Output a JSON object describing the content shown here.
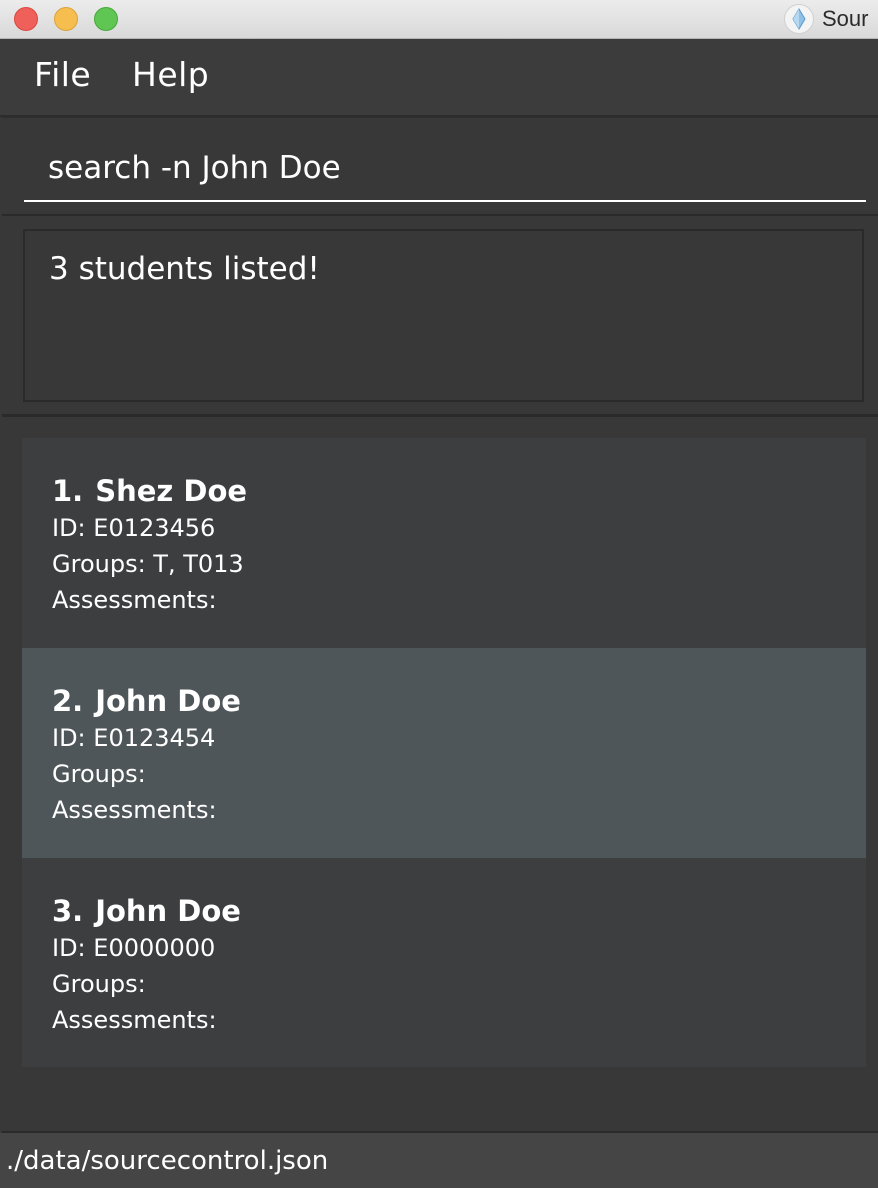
{
  "window": {
    "title": "Sour",
    "icon": "diamond-logo-icon"
  },
  "menu": {
    "file": "File",
    "help": "Help"
  },
  "command": {
    "value": "search -n John Doe"
  },
  "result": {
    "message": "3 students listed!"
  },
  "students": [
    {
      "index": "1.",
      "name": "Shez Doe",
      "id": "ID: E0123456",
      "groups": "Groups: T, T013",
      "assessments": "Assessments:"
    },
    {
      "index": "2.",
      "name": "John Doe",
      "id": "ID: E0123454",
      "groups": "Groups:",
      "assessments": "Assessments:"
    },
    {
      "index": "3.",
      "name": "John Doe",
      "id": "ID: E0000000",
      "groups": "Groups:",
      "assessments": "Assessments:"
    }
  ],
  "status": {
    "path": "./data/sourcecontrol.json"
  },
  "colors": {
    "background": "#383838",
    "selected_card": "#4f5659",
    "card": "#3c3e40",
    "close": "#f0605a",
    "minimize": "#f6be4f",
    "maximize": "#5fc553"
  }
}
